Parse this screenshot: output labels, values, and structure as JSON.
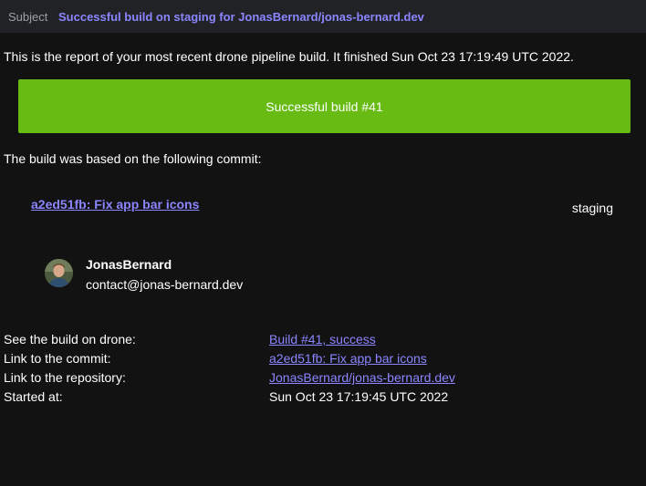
{
  "header": {
    "subject_label": "Subject",
    "subject": "Successful build on staging for JonasBernard/jonas-bernard.dev"
  },
  "email": {
    "intro": "This is the report of your most recent drone pipeline build. It finished Sun Oct 23 17:19:49 UTC 2022.",
    "banner": "Successful build #41",
    "banner_color": "#67bb13",
    "based_on": "The build was based on the following commit:",
    "commit_link": "a2ed51fb: Fix app bar icons",
    "branch": "staging",
    "author": {
      "name": "JonasBernard",
      "email": "contact@jonas-bernard.dev"
    },
    "info": [
      {
        "label": "See the build on drone:",
        "value": "Build #41, success"
      },
      {
        "label": "Link to the commit:",
        "value": "a2ed51fb: Fix app bar icons"
      },
      {
        "label": "Link to the repository:",
        "value": "JonasBernard/jonas-bernard.dev"
      },
      {
        "label": "Started at:",
        "value": "Sun Oct 23 17:19:45 UTC 2022"
      }
    ]
  },
  "colors": {
    "link": "#8b86ff",
    "header_bg": "#202226",
    "body_bg": "#121212"
  }
}
